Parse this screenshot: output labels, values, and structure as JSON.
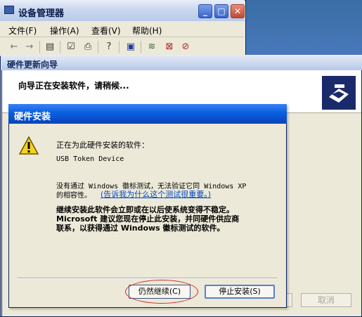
{
  "device_manager": {
    "title": "设备管理器",
    "menu": [
      "文件(F)",
      "操作(A)",
      "查看(V)",
      "帮助(H)"
    ],
    "toolbar_icons": [
      "back-icon",
      "forward-icon",
      "properties-icon",
      "list-icon",
      "print-icon",
      "help-icon",
      "monitor-icon",
      "scan-icon",
      "disable-icon",
      "uninstall-icon"
    ]
  },
  "wizard": {
    "title": "硬件更新向导",
    "header_text": "向导正在安装软件，请稍候...",
    "cancel_label": "取消"
  },
  "dialog": {
    "title": "硬件安装",
    "installing_text": "正在为此硬件安装的软件：",
    "device_name": "USB Token Device",
    "nopass_text": "没有通过 Windows 徽标测试，无法验证它同 Windows XP",
    "compat_text": "的相容性。",
    "link_text": "(告诉我为什么这个测试很重要。)",
    "warning_lines": [
      "继续安装此软件会立即或在以后使系统变得不稳定。",
      "Microsoft 建议您现在停止此安装，并同硬件供应商",
      "联系，以获得通过 Windows 徽标测试的软件。"
    ],
    "continue_label": "仍然继续(C)",
    "stop_label": "停止安装(S)"
  },
  "colors": {
    "title_bar_blue": "#0a5fe0",
    "link_blue": "#0047c4",
    "highlight_circle": "#d03030"
  }
}
